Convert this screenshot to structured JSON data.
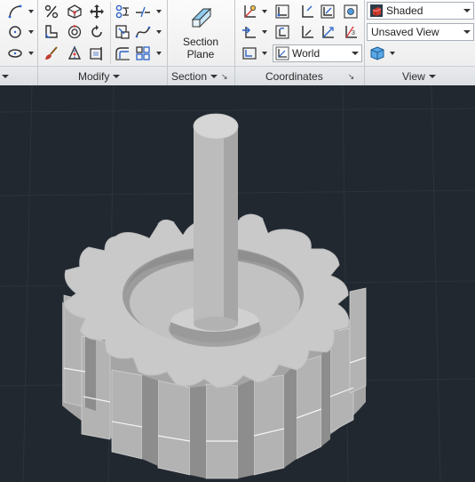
{
  "ribbon": {
    "panels": {
      "modify": {
        "label": "Modify"
      },
      "section": {
        "label": "Section",
        "button_label_line1": "Section",
        "button_label_line2": "Plane"
      },
      "coordinates": {
        "label": "Coordinates",
        "ucs_combo": {
          "value": "World",
          "icon": "world-ucs-icon"
        }
      },
      "view": {
        "label": "View",
        "visual_style": {
          "value": "Shaded",
          "icon": "shaded-style-icon"
        },
        "named_view": {
          "value": "Unsaved View"
        }
      }
    }
  },
  "viewport": {
    "background": "#212830",
    "grid_color": "#2c343d",
    "model_color": "#c9c9c9",
    "model": "3d-gear-with-shaft"
  }
}
